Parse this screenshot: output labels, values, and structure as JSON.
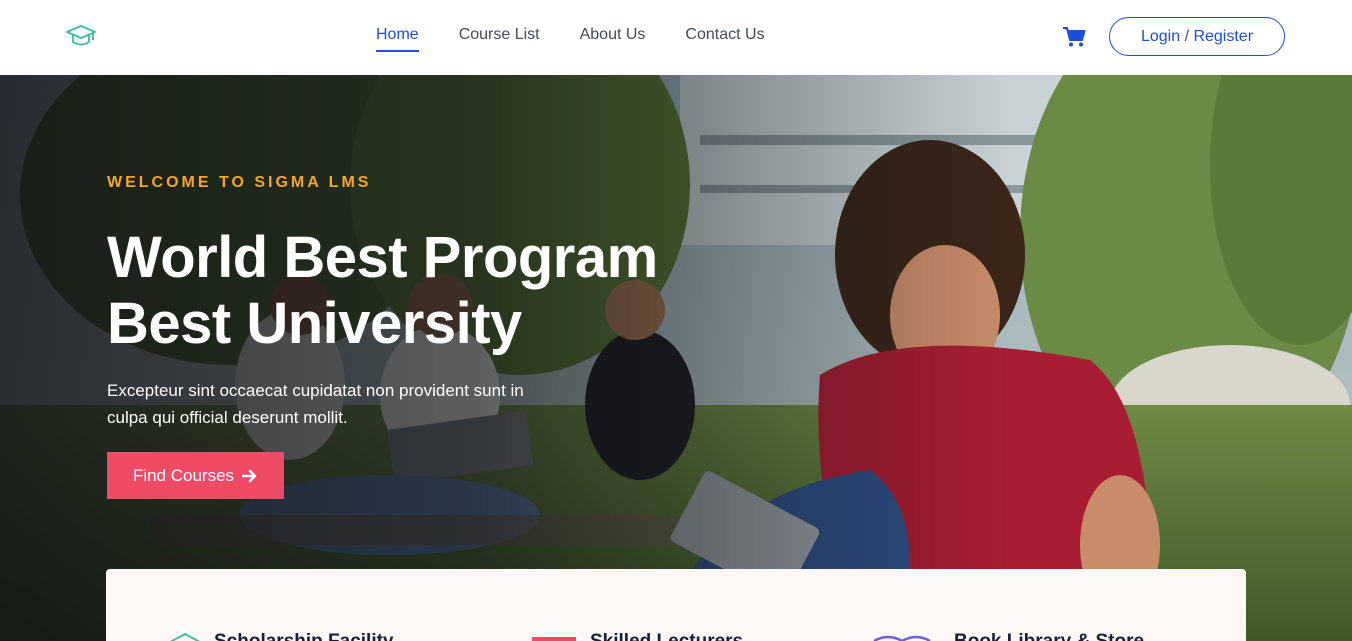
{
  "header": {
    "logo_icon": "graduation-cap-icon",
    "nav": [
      {
        "label": "Home",
        "active": true
      },
      {
        "label": "Course List",
        "active": false
      },
      {
        "label": "About Us",
        "active": false
      },
      {
        "label": "Contact Us",
        "active": false
      }
    ],
    "cart_icon": "shopping-cart-icon",
    "login_label": "Login / Register"
  },
  "hero": {
    "eyebrow": "WELCOME TO SIGMA LMS",
    "title_line1": "World Best Program",
    "title_line2": "Best University",
    "description": "Excepteur sint occaecat cupidatat non provident sunt in culpa qui official deserunt mollit.",
    "cta_label": "Find Courses",
    "cta_icon": "arrow-right-icon"
  },
  "features": [
    {
      "label": "Scholarship Facility",
      "icon": "scholarship-icon"
    },
    {
      "label": "Skilled Lecturers",
      "icon": "lecturer-icon"
    },
    {
      "label": "Book Library & Store",
      "icon": "library-icon"
    }
  ],
  "colors": {
    "accent": "#1d4ed8",
    "eyebrow": "#f5a623",
    "cta": "#ef4b67",
    "logo": "#3bbf9f",
    "panel_bg": "#fdf7f6"
  }
}
